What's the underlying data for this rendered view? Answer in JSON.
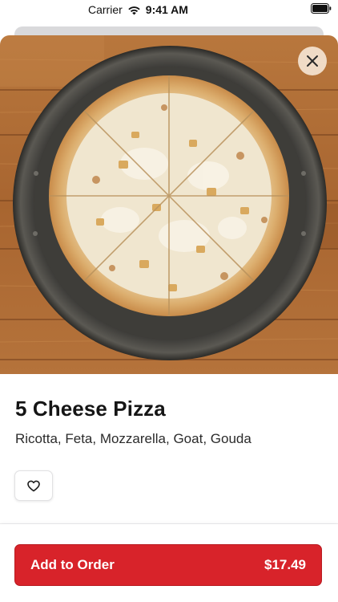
{
  "status_bar": {
    "carrier": "Carrier",
    "time": "9:41 AM",
    "icons": [
      "wifi-icon",
      "battery-icon"
    ]
  },
  "modal": {
    "close_icon": "close-icon"
  },
  "item": {
    "name": "5 Cheese Pizza",
    "description": "Ricotta, Feta, Mozzarella, Goat, Gouda",
    "favorite_icon": "heart-icon"
  },
  "order_button": {
    "label": "Add to Order",
    "price": "$17.49"
  },
  "colors": {
    "accent": "#d8232a",
    "text_primary": "#151515",
    "text_secondary": "#2b2b2b"
  }
}
